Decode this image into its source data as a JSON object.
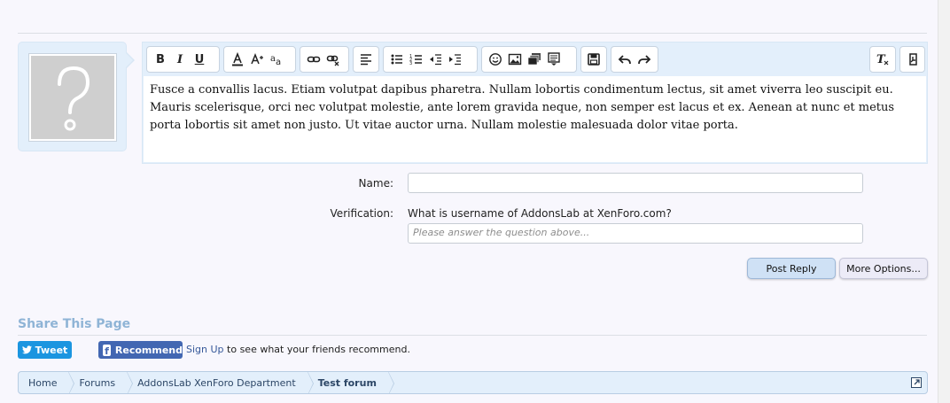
{
  "editor": {
    "toolbar": {
      "bold": "B",
      "italic": "I",
      "underline": "U",
      "icons": [
        "bold-icon",
        "italic-icon",
        "underline-icon",
        "text-color-icon",
        "font-size-icon",
        "font-family-icon",
        "link-icon",
        "unlink-icon",
        "align-icon",
        "bullet-list-icon",
        "numbered-list-icon",
        "outdent-icon",
        "indent-icon",
        "smilie-icon",
        "image-icon",
        "media-icon",
        "insert-more-icon",
        "save-draft-icon",
        "undo-icon",
        "redo-icon",
        "remove-format-icon",
        "toggle-bbcode-icon"
      ]
    },
    "content": "Fusce a convallis lacus. Etiam volutpat dapibus pharetra. Nullam lobortis condimentum lectus, sit amet viverra leo suscipit eu. Mauris scelerisque, orci nec volutpat molestie, ante lorem gravida neque, non semper est lacus et ex. Aenean at nunc et metus porta lobortis sit amet non justo. Ut vitae auctor urna. Nullam molestie malesuada dolor vitae porta."
  },
  "form": {
    "name_label": "Name:",
    "name_value": "",
    "verification_label": "Verification:",
    "question": "What is username of AddonsLab at XenForo.com?",
    "answer_placeholder": "Please answer the question above...",
    "post_reply": "Post Reply",
    "more_options": "More Options..."
  },
  "share": {
    "title": "Share This Page",
    "tweet": "Tweet",
    "recommend": "Recommend",
    "signup": "Sign Up",
    "signup_rest": " to see what your friends recommend."
  },
  "breadcrumb": {
    "items": [
      "Home",
      "Forums",
      "AddonsLab XenForo Department",
      "Test forum"
    ]
  },
  "colors": {
    "accent": "#1b95e0",
    "facebook": "#4267b2",
    "share_title": "#8fb4d6",
    "panel": "#e3effb"
  }
}
